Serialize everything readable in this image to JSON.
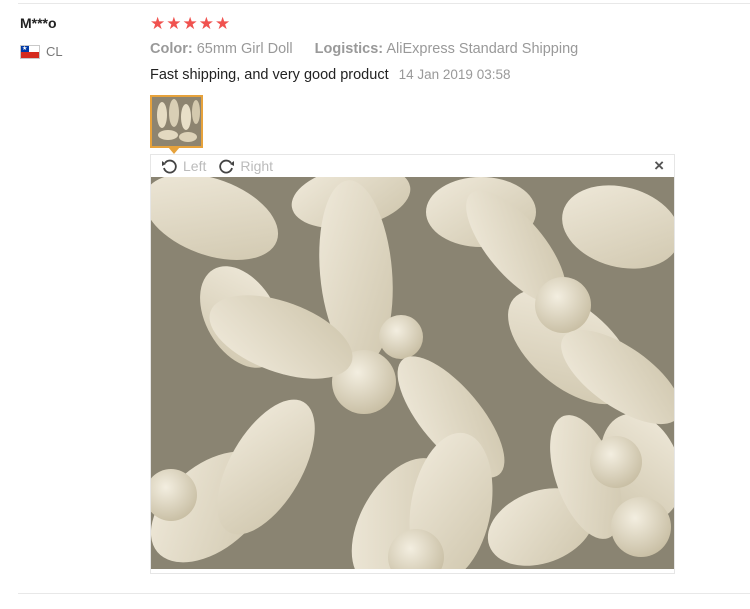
{
  "review": {
    "user": "M***o",
    "country_code": "CL",
    "rating": 5,
    "color_label": "Color:",
    "color_value": "65mm Girl Doll",
    "logistics_label": "Logistics:",
    "logistics_value": "AliExpress Standard Shipping",
    "text": "Fast shipping, and very good product",
    "date": "14 Jan 2019 03:58"
  },
  "viewer": {
    "rotate_left": "Left",
    "rotate_right": "Right",
    "close_glyph": "×"
  },
  "icons": {
    "star": "★",
    "rotate_left": "rotate-left-icon",
    "rotate_right": "rotate-right-icon",
    "close": "close-icon"
  },
  "colors": {
    "star": "#f0524f",
    "thumb_border": "#e6a23c",
    "muted": "#999999"
  }
}
